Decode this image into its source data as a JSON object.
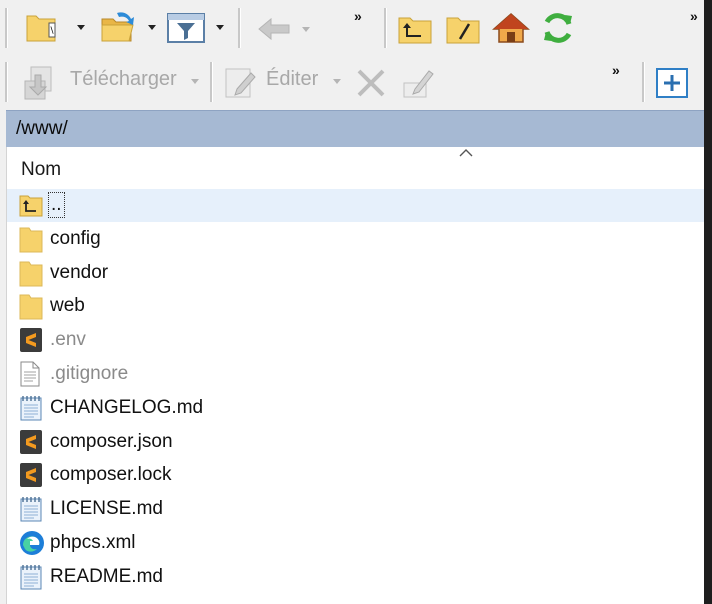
{
  "toolbar1": {
    "overflow": "»",
    "overflow2": "»"
  },
  "toolbar2": {
    "download_label": "Télécharger",
    "edit_label": "Éditer",
    "overflow": "»"
  },
  "path": {
    "current": "/www/"
  },
  "list": {
    "column_name": "Nom",
    "files": [
      {
        "name": "..",
        "type": "parent-dir"
      },
      {
        "name": "config",
        "type": "folder"
      },
      {
        "name": "vendor",
        "type": "folder"
      },
      {
        "name": "web",
        "type": "folder"
      },
      {
        "name": ".env",
        "type": "sublime",
        "hidden": true
      },
      {
        "name": ".gitignore",
        "type": "text",
        "hidden": true
      },
      {
        "name": "CHANGELOG.md",
        "type": "notepad"
      },
      {
        "name": "composer.json",
        "type": "sublime"
      },
      {
        "name": "composer.lock",
        "type": "sublime"
      },
      {
        "name": "LICENSE.md",
        "type": "notepad"
      },
      {
        "name": "phpcs.xml",
        "type": "edge"
      },
      {
        "name": "README.md",
        "type": "notepad"
      }
    ]
  },
  "colors": {
    "pathbar_bg": "#a6b9d3",
    "folder_yellow": "#f6d26b",
    "selected_row": "#e6f0fb",
    "sublime_orange": "#f39a1f"
  }
}
